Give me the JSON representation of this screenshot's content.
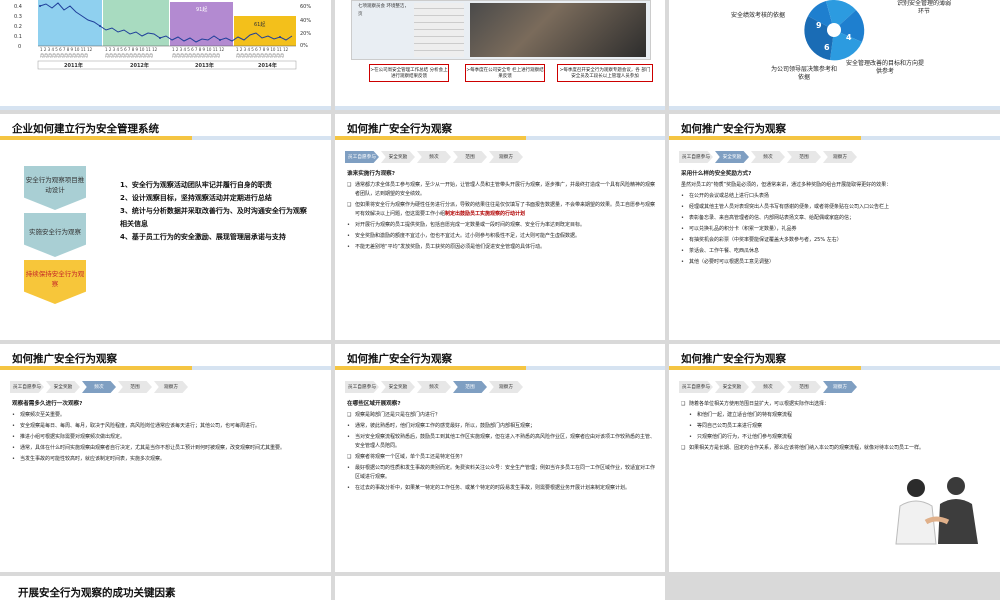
{
  "row1": {
    "chart": {
      "left_ticks": [
        "0.4",
        "0.3",
        "0.2",
        "0.1",
        "0"
      ],
      "right_ticks": [
        "60%",
        "40%",
        "20%",
        "0%"
      ],
      "years": [
        "2011年",
        "2012年",
        "2013年",
        "2014年"
      ],
      "annot": [
        "91起",
        "61起"
      ]
    },
    "photo": {
      "label": "七项观察员会 环境整洁，页",
      "captions": [
        "≻在公司周安全管理工作总结 分析会上进行观察结果反馈",
        "≻每季度在公司安全专 栏上进行观察结果反馈",
        "≻每季度召开安全行为观察专题会议，各 部门安全员及工段长以上管理人员参加"
      ]
    },
    "wheel": {
      "labels": [
        "安全绩效考核的依据",
        "为公司领导层决策参考和依据",
        "安全管理改善的目标和方向提供参考",
        "识别安全管理的薄弱环节"
      ],
      "numbers": [
        "9",
        "6",
        "4"
      ]
    }
  },
  "slide_a": {
    "title": "企业如何建立行为安全管理系统",
    "chevrons": [
      "安全行为观察项目推动设计",
      "实施安全行为观察",
      "持续保持安全行为观察"
    ],
    "steps": [
      "1、安全行为观察活动团队牢记并履行自身的职责",
      "2、设计观察目标，坚持观察活动并定期进行总结",
      "3、统计与分析数据并采取改善行为、及时沟通安全行为观察相关信息",
      "4、基于员工行为的安全激励、展现管理层承诺与支持"
    ]
  },
  "tabs": [
    "员工自愿参与",
    "安全奖励",
    "频次",
    "范围",
    "观察方"
  ],
  "slide_b": {
    "title": "如何推广安全行为观察",
    "q": "谁来实施行为观察?",
    "points": [
      "通常都力求全体员工参与观察，至少从一开始，让管理人员和主管带头开展行为观察，逐步推广，并最终打造成一个具有风险精神的观察者团队，达到期望的安全绩效。",
      "但如果将安全行为观察作为硬性任务进行分派，导致的结果往往是仅仅填写了书面报告数据量，不会带来期望的效果。员工自愿参与观察可有效解决以上问题，但这需要工作小组",
      "对开展行为观察的员工提供奖励，包括自愿完成一定数量或一段时间的观察、安全行为率达到既定目标。",
      "安全奖励和激励的额度不宜过小，但也不宜过大。过小则参与积极性不足，过大则可能产生虚假数据。",
      "不能无差别地“平均”发放奖励，员工获奖的原因必须是他们促进安全管理的具体行动。"
    ],
    "red": "制定出鼓励员工实施观察的行动计划"
  },
  "slide_c": {
    "title": "如何推广安全行为观察",
    "q": "采用什么样的安全奖励方式?",
    "intro": "虽然对员工的“物质”奖励是必须的，但通常来讲，通过多种奖励的组合开展能取得更好的效果：",
    "points": [
      "在公开的会议或总结上进行口头表扬",
      "经理或其他主管人员对表现突出人员书写有感谢的便条，或者将便条贴在公司入口公告栏上",
      "表彰备忘录、来自高管理者的信、内部网站表扬文章、给配偶或家庭的信；",
      "可以兑换礼品的积分卡（积累一定数量），礼品券",
      "有抽奖机会的彩票（中奖率要能保证覆盖大多数参与者，25% 左右）",
      "茶话会、工作午餐、吃西瓜休息",
      "其他（必要时可以根据员工意见调整）"
    ]
  },
  "slide_d": {
    "title": "如何推广安全行为观察",
    "q": "观察者需多久进行一次观察?",
    "points": [
      "观察频次至关重要。",
      "安全观察是每日、每周、每月，取决于风险程度，高风险岗位通常应该每天进行；其他公司，也可每周进行。",
      "推进小组可根据实际需要对观察频次做出规定。",
      "通常，具体在什么时间实施观察由观察者自行决定，尤其是当你不想让员工预计到何时被观察，改变观察时间尤其重要。",
      "当发生事故的可能性较高时，就应该制定时间表，实施多次观察。"
    ]
  },
  "slide_e": {
    "title": "如何推广安全行为观察",
    "q": "在哪些区域开展观察?",
    "points": [
      "观察是跨部门还是只是在部门内进行？",
      "通常，彼此熟悉时，他们对观察工作的感觉最好，所以，鼓励部门内部相互观察；",
      "当对安全观察流程较熟悉后，鼓励员工到其他工作区实施观察，但在进入不熟悉的高风险作业区，观察者应由对该项工作较熟悉的主管、安全管理人员陪同。",
      "观察者将观察一个区域，单个员工还是特定任务？",
      "最好根据公司的性质和发生事故的类别而定。免费资料关注公众号：安全生产管理；例如当许多员工在同一工作区域作业，较适宜对工作区域进行观察。",
      "在过去的事故分析中，如果某一特定的工作任务、或某个特定的时段易发生事故，则需要根据业务开展计划来制定观察计划。"
    ]
  },
  "slide_f": {
    "title": "如何推广安全行为观察",
    "lead": "随着各单位相关方使用范围日益扩大，可以根据实际作出选择：",
    "points": [
      "和他们一起，建立适合他们的特有观察流程",
      "等同自己公司员工来进行观察",
      "只观察他们的行为，不让他们参与观察流程"
    ],
    "tail": "如果相关方是长期、固定的合作关系，那么应该将他们纳入本公司的观察流程，就像对待本公司员工一样。"
  },
  "slide_g": {
    "title": "开展安全行为观察的成功关键因素"
  }
}
